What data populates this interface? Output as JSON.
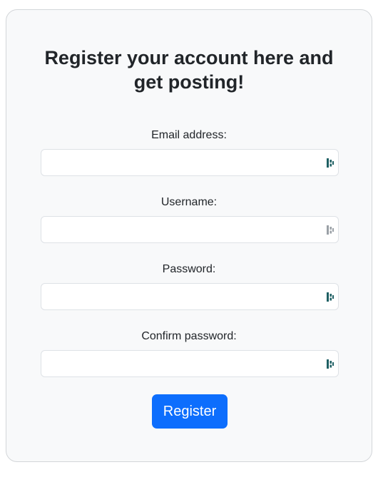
{
  "form": {
    "title_line1": "Register your account here and",
    "title_line2": "get posting!",
    "fields": [
      {
        "label": "Email address:",
        "value": "",
        "placeholder": ""
      },
      {
        "label": "Username:",
        "value": "",
        "placeholder": ""
      },
      {
        "label": "Password:",
        "value": "",
        "placeholder": ""
      },
      {
        "label": "Confirm password:",
        "value": "",
        "placeholder": ""
      }
    ],
    "submit_label": "Register"
  },
  "icons": {
    "password_manager": "password-manager-icon"
  },
  "colors": {
    "card_bg": "#f8f9fa",
    "button_bg": "#0d6efd",
    "icon_active": "#1e5f63",
    "icon_inactive": "#9aa0a6"
  }
}
